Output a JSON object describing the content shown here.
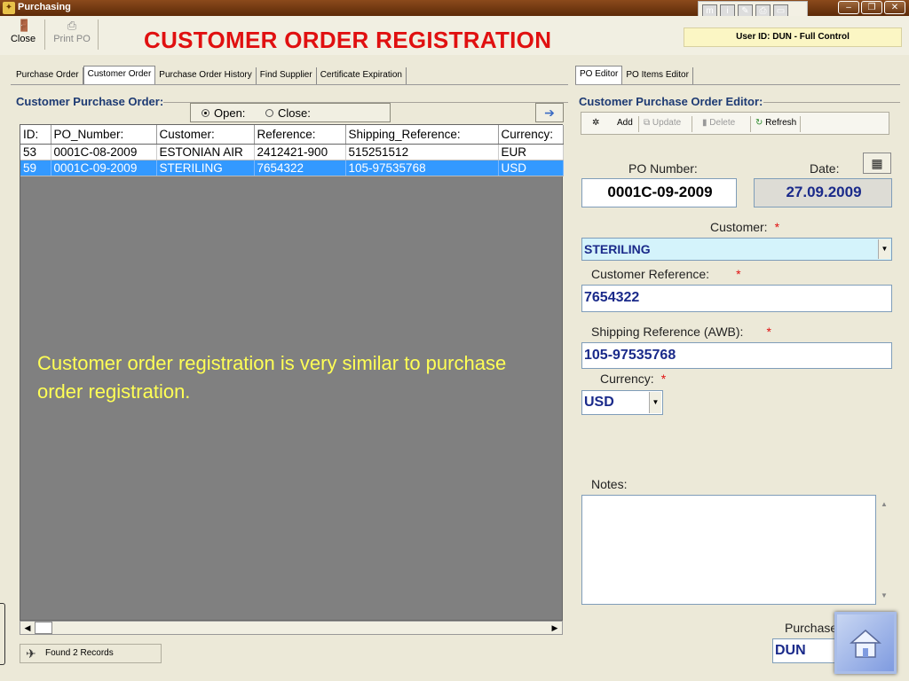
{
  "window": {
    "title": "Purchasing"
  },
  "toolbar": {
    "close_label": "Close",
    "print_label": "Print PO"
  },
  "page_title": "CUSTOMER ORDER REGISTRATION",
  "user_info": "User ID: DUN - Full Control",
  "left_tabs": [
    "Purchase Order",
    "Customer Order",
    "Purchase Order History",
    "Find Supplier",
    "Certificate Expiration"
  ],
  "right_tabs": [
    "PO Editor",
    "PO Items Editor"
  ],
  "list": {
    "title": "Customer Purchase Order:",
    "filter_open": "Open:",
    "filter_close": "Close:",
    "columns": [
      "ID:",
      "PO_Number:",
      "Customer:",
      "Reference:",
      "Shipping_Reference:",
      "Currency:"
    ],
    "rows": [
      [
        "53",
        "0001C-08-2009",
        "ESTONIAN AIR",
        "2412421-900",
        "515251512",
        "EUR"
      ],
      [
        "59",
        "0001C-09-2009",
        "STERILING",
        "7654322",
        "105-97535768",
        "USD"
      ]
    ],
    "selected_row": 1,
    "status": "Found 2 Records"
  },
  "note": "Customer order registration is very similar to purchase order registration.",
  "editor": {
    "title": "Customer Purchase Order Editor:",
    "toolbar": {
      "add": "Add",
      "update": "Update",
      "delete": "Delete",
      "refresh": "Refresh"
    },
    "po_number_label": "PO Number:",
    "po_number": "0001C-09-2009",
    "date_label": "Date:",
    "date": "27.09.2009",
    "customer_label": "Customer:",
    "customer": "STERILING",
    "customer_ref_label": "Customer Reference:",
    "customer_ref": "7654322",
    "shipping_ref_label": "Shipping Reference (AWB):",
    "shipping_ref": "105-97535768",
    "currency_label": "Currency:",
    "currency": "USD",
    "notes_label": "Notes:",
    "purchaser_label": "Purchaser",
    "purchaser": "DUN",
    "required_mark": "*"
  },
  "colors": {
    "title_red": "#e01010",
    "selection_blue": "#3399ff",
    "group_title": "#1d3a73",
    "field_text": "#1a2a8a"
  }
}
